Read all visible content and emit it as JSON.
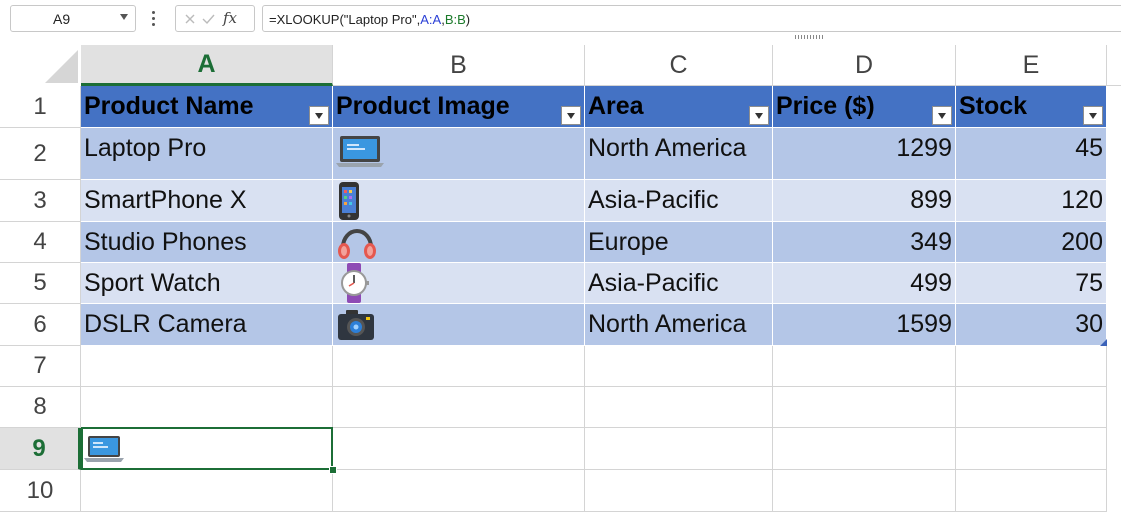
{
  "formula_bar": {
    "name_box": "A9",
    "fx_label": "fx",
    "formula_prefix": "=XLOOKUP(\"Laptop Pro\",",
    "formula_ref1": "A:A",
    "formula_comma": ",",
    "formula_ref2": "B:B",
    "formula_suffix": ")"
  },
  "columns": [
    "A",
    "B",
    "C",
    "D",
    "E"
  ],
  "rows": [
    "1",
    "2",
    "3",
    "4",
    "5",
    "6",
    "7",
    "8",
    "9",
    "10"
  ],
  "table": {
    "headers": [
      "Product Name",
      "Product Image",
      "Area",
      "Price ($)",
      "Stock"
    ],
    "records": [
      {
        "name": "Laptop Pro",
        "image": "laptop-icon",
        "area": "North America",
        "price": "1299",
        "stock": "45"
      },
      {
        "name": "SmartPhone X",
        "image": "smartphone-icon",
        "area": "Asia-Pacific",
        "price": "899",
        "stock": "120"
      },
      {
        "name": "Studio Phones",
        "image": "headphones-icon",
        "area": "Europe",
        "price": "349",
        "stock": "200"
      },
      {
        "name": "Sport Watch",
        "image": "watch-icon",
        "area": "Asia-Pacific",
        "price": "499",
        "stock": "75"
      },
      {
        "name": "DSLR Camera",
        "image": "camera-icon",
        "area": "North America",
        "price": "1599",
        "stock": "30"
      }
    ]
  },
  "selected_cell": {
    "ref": "A9",
    "content_icon": "laptop-icon"
  },
  "colors": {
    "header_fill": "#4472c4",
    "band_dark": "#b4c6e7",
    "band_light": "#d9e1f2",
    "selection": "#1c6e36"
  }
}
